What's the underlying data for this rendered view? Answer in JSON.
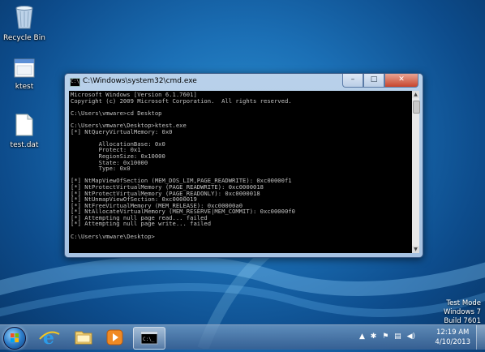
{
  "desktop": {
    "icons": [
      {
        "label": "Recycle Bin",
        "icon": "recycle-bin-icon"
      },
      {
        "label": "ktest",
        "icon": "application-icon"
      },
      {
        "label": "test.dat",
        "icon": "file-icon"
      }
    ]
  },
  "window": {
    "title": "C:\\Windows\\system32\\cmd.exe",
    "minimize": "–",
    "maximize": "□",
    "close": "✕",
    "console_lines": [
      "Microsoft Windows [Version 6.1.7601]",
      "Copyright (c) 2009 Microsoft Corporation.  All rights reserved.",
      "",
      "C:\\Users\\vmware>cd Desktop",
      "",
      "C:\\Users\\vmware\\Desktop>ktest.exe",
      "[*] NtQueryVirtualMemory: 0x0",
      "",
      "        AllocationBase: 0x0",
      "        Protect: 0x1",
      "        RegionSize: 0x10000",
      "        State: 0x10000",
      "        Type: 0x0",
      "",
      "[*] NtMapViewOfSection (MEM_DOS_LIM,PAGE_READWRITE): 0xc00000f1",
      "[*] NtProtectVirtualMemory (PAGE_READWRITE): 0xc0000018",
      "[*] NtProtectVirtualMemory (PAGE_READONLY): 0xc0000018",
      "[*] NtUnmapViewOfSection: 0xc0000019",
      "[*] NtFreeVirtualMemory (MEM_RELEASE): 0xc00000a0",
      "[*] NtAllocateVirtualMemory (MEM_RESERVE|MEM_COMMIT): 0xc00000f0",
      "[*] Attempting null page read... failed",
      "[*] Attempting null page write... failed",
      "",
      "C:\\Users\\vmware\\Desktop>"
    ]
  },
  "watermark": {
    "line1": "Test Mode",
    "line2": "Windows 7",
    "line3": "Build 7601"
  },
  "taskbar": {
    "pinned": [
      {
        "name": "internet-explorer",
        "icon": "internet-explorer-icon"
      },
      {
        "name": "windows-explorer",
        "icon": "folder-icon"
      },
      {
        "name": "media-player",
        "icon": "media-player-icon"
      },
      {
        "name": "cmd",
        "icon": "command-prompt-icon",
        "active": true
      }
    ],
    "clock_time": "12:19 AM",
    "clock_date": "4/10/2013"
  },
  "colors": {
    "console_bg": "#000000",
    "console_fg": "#c0c0c0",
    "wallpaper": "#1b6fb5"
  }
}
